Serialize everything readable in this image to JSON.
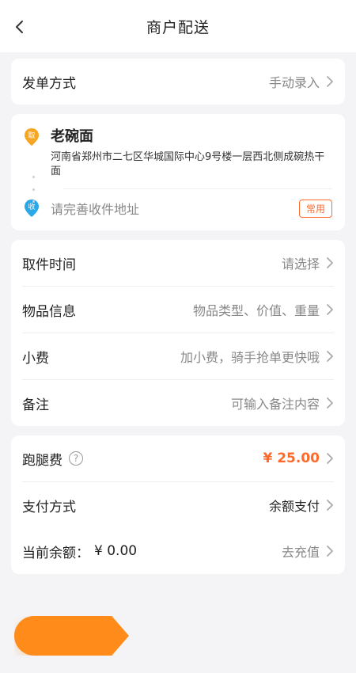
{
  "header": {
    "title": "商户配送"
  },
  "order_mode": {
    "label": "发单方式",
    "value": "手动录入"
  },
  "pickup": {
    "icon_text": "取",
    "name": "老碗面",
    "address": "河南省郑州市二七区华城国际中心9号楼一层西北侧成碗热干面",
    "pin_color": "#f5a623"
  },
  "receiver": {
    "icon_text": "收",
    "placeholder": "请完善收件地址",
    "badge": "常用",
    "pin_color": "#2aa8e8"
  },
  "details": [
    {
      "label": "取件时间",
      "value": "请选择"
    },
    {
      "label": "物品信息",
      "value": "物品类型、价值、重量"
    },
    {
      "label": "小费",
      "value": "加小费，骑手抢单更快哦"
    },
    {
      "label": "备注",
      "value": "可输入备注内容"
    }
  ],
  "fee": {
    "label": "跑腿费",
    "help": "?",
    "amount": "¥ 25.00"
  },
  "payment": {
    "label": "支付方式",
    "value": "余额支付"
  },
  "balance": {
    "label": "当前余额：",
    "amount": "¥ 0.00",
    "action": "去充值"
  }
}
